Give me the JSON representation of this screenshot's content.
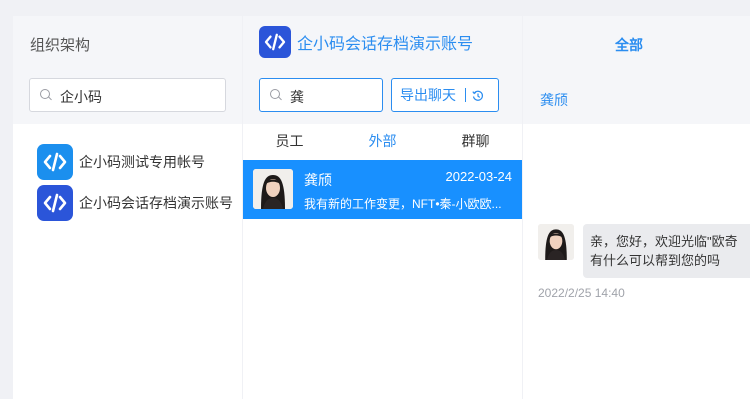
{
  "org": {
    "title": "组织架构",
    "search_value": "企小码",
    "accounts": [
      {
        "name": "企小码测试专用帐号",
        "logo": "code-brackets-icon"
      },
      {
        "name": "企小码会话存档演示账号",
        "logo": "code-brackets-icon"
      }
    ]
  },
  "chat": {
    "account_title": "企小码会话存档演示账号",
    "search_value": "龚",
    "export_label": "导出聊天",
    "tabs": [
      {
        "label": "员工",
        "active": false
      },
      {
        "label": "外部",
        "active": true
      },
      {
        "label": "群聊",
        "active": false
      }
    ],
    "conversation": {
      "name": "龚颀",
      "date": "2022-03-24",
      "preview": "我有新的工作变更，NFT•秦-小欧欧..."
    }
  },
  "messages": {
    "filter_all": "全部",
    "contact_name": "龚颀",
    "message": {
      "line1": "亲，您好，欢迎光临\"欧奇",
      "line2": "有什么可以帮到您的吗",
      "time": "2022/2/25 14:40"
    }
  },
  "colors": {
    "accent": "#2b8df0",
    "selected_row": "#1890ff",
    "logo_light": "#1b8fee",
    "logo_dark": "#2b55d9"
  }
}
